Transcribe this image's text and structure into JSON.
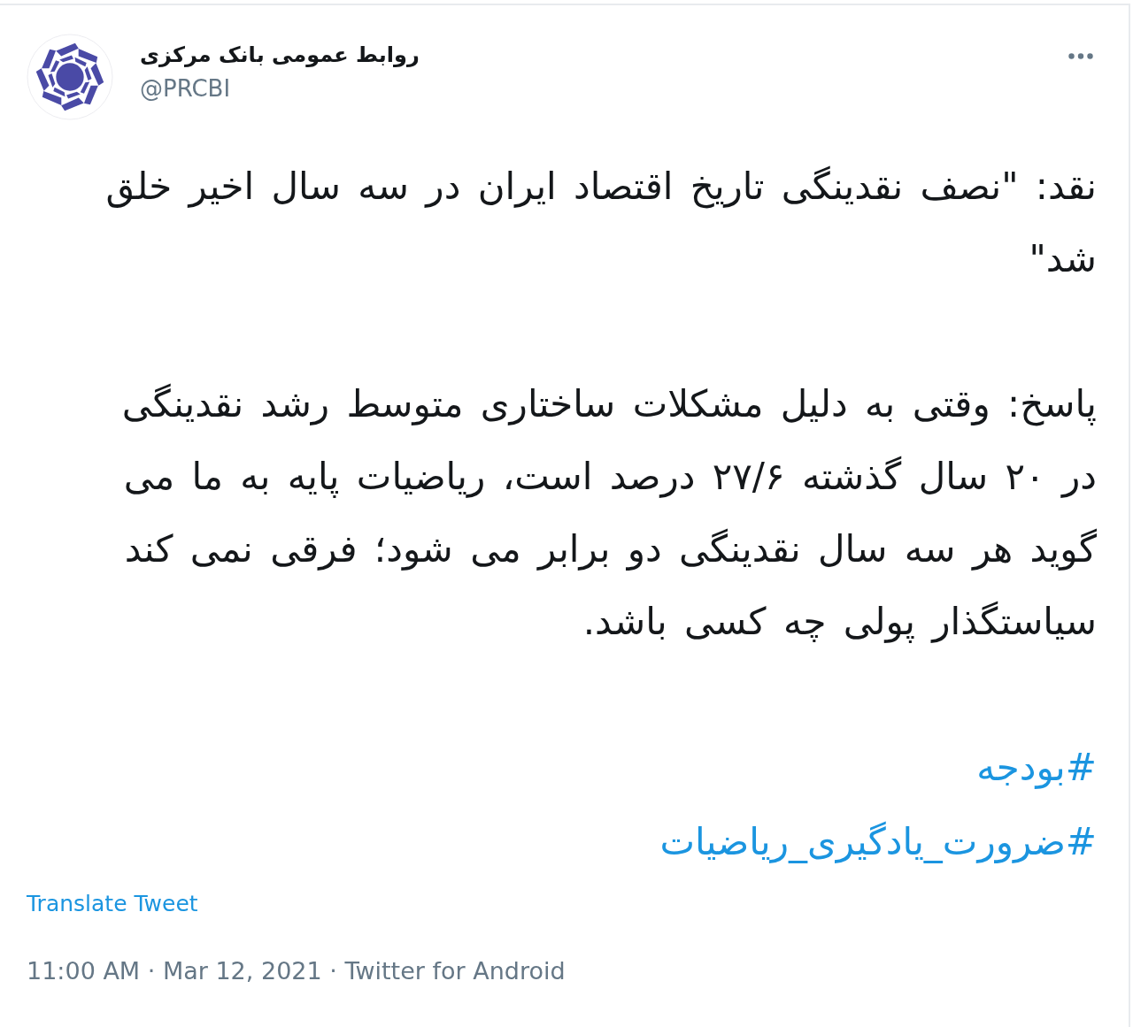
{
  "author": {
    "name": "روابط عمومی بانک مرکزی",
    "handle": "@PRCBI"
  },
  "tweet": {
    "paragraphs": [
      "نقد: \"نصف نقدینگی تاریخ اقتصاد ایران در سه سال اخیر خلق شد\"",
      "پاسخ: وقتی به دلیل مشکلات ساختاری متوسط رشد نقدینگی در ۲۰ سال گذشته ۲۷/۶ درصد است، ریاضیات پایه به ما می گوید هر سه سال نقدینگی دو برابر می شود؛ فرقی نمی کند سیاستگذار پولی چه کسی باشد."
    ],
    "hashtags": [
      "#بودجه",
      "#ضرورت_یادگیری_ریاضیات"
    ],
    "translate_link": "Translate Tweet"
  },
  "meta": {
    "timestamp": "11:00 AM · Mar 12, 2021 · Twitter for Android"
  }
}
